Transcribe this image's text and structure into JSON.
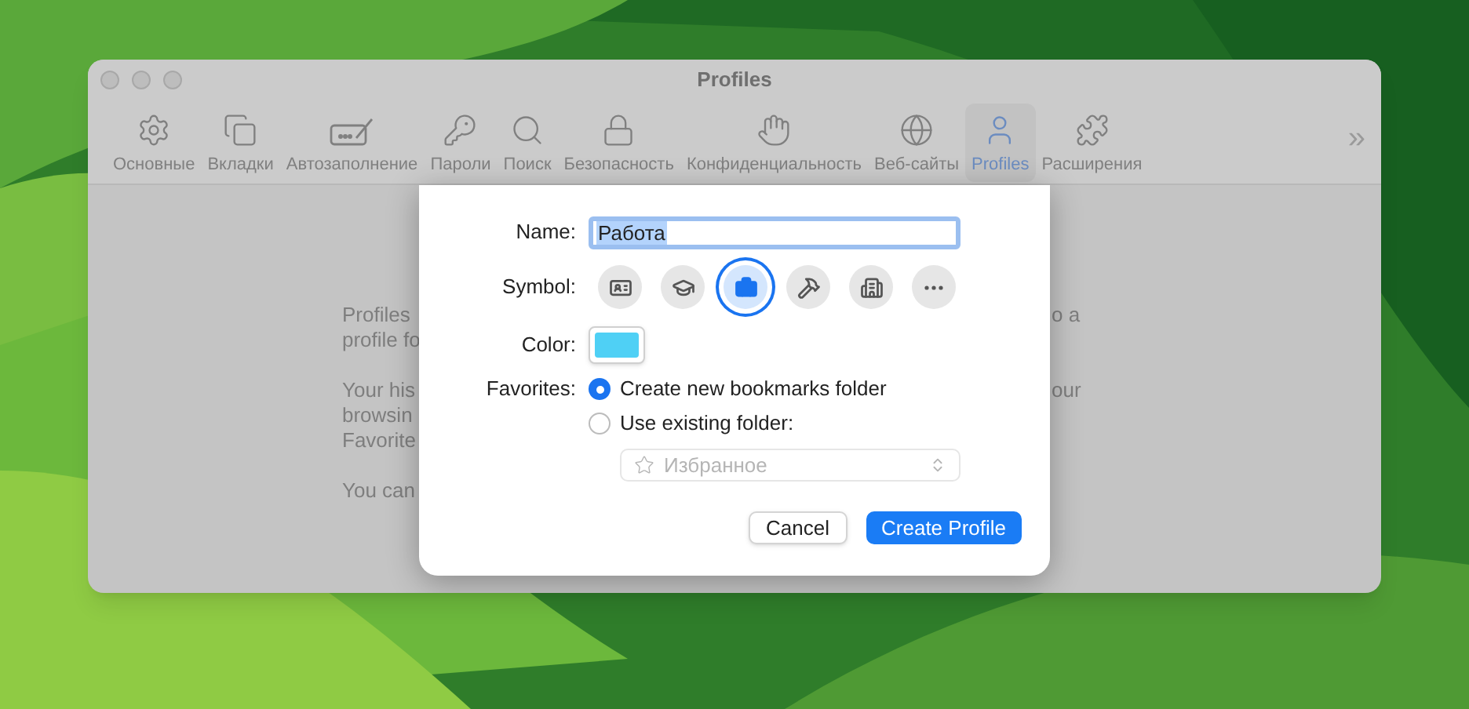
{
  "window": {
    "title": "Profiles"
  },
  "toolbar": {
    "items": [
      {
        "label": "Основные",
        "selected": false
      },
      {
        "label": "Вкладки",
        "selected": false
      },
      {
        "label": "Автозаполнение",
        "selected": false
      },
      {
        "label": "Пароли",
        "selected": false
      },
      {
        "label": "Поиск",
        "selected": false
      },
      {
        "label": "Безопасность",
        "selected": false
      },
      {
        "label": "Конфиденциальность",
        "selected": false
      },
      {
        "label": "Веб-сайты",
        "selected": false
      },
      {
        "label": "Profiles",
        "selected": true
      },
      {
        "label": "Расширения",
        "selected": false
      }
    ],
    "overflow": "»"
  },
  "background_text": {
    "left": [
      "Profiles",
      "profile fo",
      "Your his",
      "browsin",
      "Favorite",
      "You can"
    ],
    "right": [
      "o a",
      "our"
    ]
  },
  "sheet": {
    "name": {
      "label": "Name:",
      "value": "Работа",
      "text_selected": true
    },
    "symbol": {
      "label": "Symbol:",
      "options": [
        {
          "selected": false
        },
        {
          "selected": false
        },
        {
          "selected": true
        },
        {
          "selected": false
        },
        {
          "selected": false
        },
        {
          "selected": false
        }
      ]
    },
    "color": {
      "label": "Color:",
      "color": "#4fd0f5"
    },
    "favorites": {
      "label": "Favorites:",
      "options": [
        {
          "label": "Create new bookmarks folder",
          "selected": true
        },
        {
          "label": "Use existing folder:",
          "selected": false
        }
      ],
      "folder": {
        "value": "Избранное",
        "disabled": true
      }
    },
    "buttons": [
      {
        "label": "Cancel",
        "kind": "secondary"
      },
      {
        "label": "Create Profile",
        "kind": "primary"
      }
    ]
  }
}
